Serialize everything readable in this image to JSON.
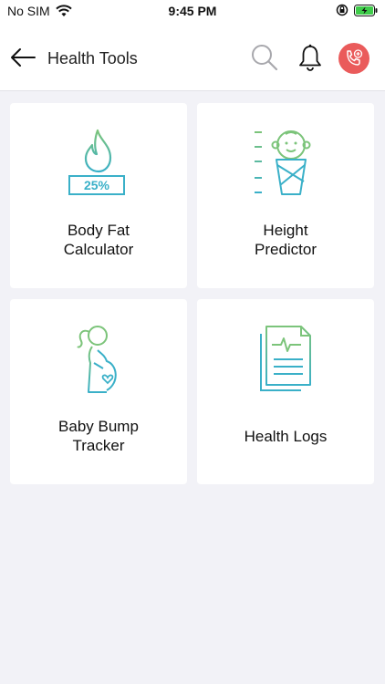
{
  "status_bar": {
    "carrier": "No SIM",
    "time": "9:45 PM"
  },
  "header": {
    "title": "Health Tools"
  },
  "cards": [
    {
      "label": "Body Fat\nCalculator",
      "badge": "25%",
      "icon": "flame-scale-icon"
    },
    {
      "label": "Height\nPredictor",
      "icon": "baby-ruler-icon"
    },
    {
      "label": "Baby Bump\nTracker",
      "icon": "pregnant-woman-icon"
    },
    {
      "label": "Health Logs",
      "icon": "document-logs-icon"
    }
  ],
  "colors": {
    "accent_red": "#ea5b5b",
    "icon_green": "#7cc47a",
    "icon_teal": "#3ab0c8"
  }
}
